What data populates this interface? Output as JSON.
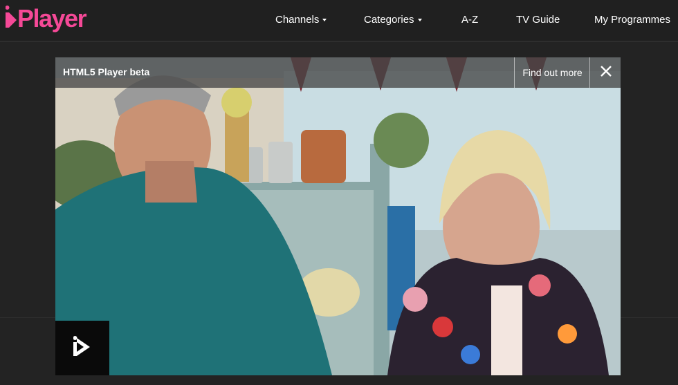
{
  "brand": {
    "logo_text": "Player",
    "accent": "#f54997"
  },
  "nav": {
    "items": [
      {
        "label": "Channels",
        "dropdown": true
      },
      {
        "label": "Categories",
        "dropdown": true
      },
      {
        "label": "A-Z",
        "dropdown": false
      },
      {
        "label": "TV Guide",
        "dropdown": false
      },
      {
        "label": "My Programmes",
        "dropdown": false
      }
    ]
  },
  "player": {
    "banner_title": "HTML5 Player beta",
    "find_out_more": "Find out more",
    "close_icon": "close-icon",
    "play_icon": "iplayer-play-icon"
  }
}
